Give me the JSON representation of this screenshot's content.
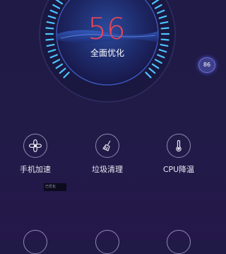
{
  "gauge": {
    "score": "56",
    "status_label": "全面优化"
  },
  "floating_ball": {
    "value": "86"
  },
  "tools": [
    {
      "label": "手机加速",
      "icon": "flower-icon"
    },
    {
      "label": "垃圾清理",
      "icon": "broom-icon"
    },
    {
      "label": "CPU降温",
      "icon": "thermometer-icon"
    }
  ],
  "toast": {
    "text": "已优化"
  },
  "colors": {
    "score": "#e8475a",
    "ring": "#4cc4ff",
    "background": "#211b47"
  }
}
